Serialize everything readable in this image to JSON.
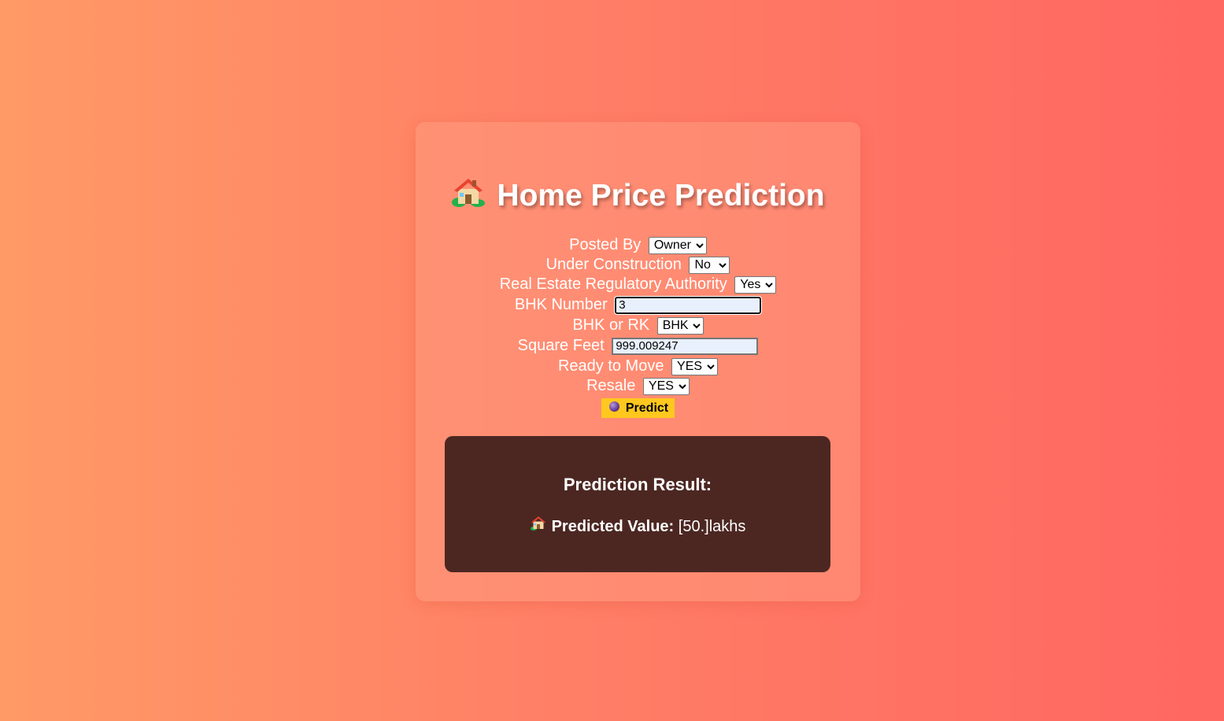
{
  "title": "Home Price Prediction",
  "icons": {
    "title": "house-icon",
    "predict": "crystal-ball-icon",
    "result": "house-icon"
  },
  "form": {
    "posted_by": {
      "label": "Posted By",
      "value": "Owner",
      "options": [
        "Owner"
      ]
    },
    "under_construction": {
      "label": "Under Construction",
      "value": "No",
      "options": [
        "No"
      ]
    },
    "rera": {
      "label": "Real Estate Regulatory Authority",
      "value": "Yes",
      "options": [
        "Yes"
      ]
    },
    "bhk_number": {
      "label": "BHK Number",
      "value": "3"
    },
    "bhk_or_rk": {
      "label": "BHK or RK",
      "value": "BHK",
      "options": [
        "BHK"
      ]
    },
    "square_feet": {
      "label": "Square Feet",
      "value": "999.009247"
    },
    "ready_to_move": {
      "label": "Ready to Move",
      "value": "YES",
      "options": [
        "YES"
      ]
    },
    "resale": {
      "label": "Resale",
      "value": "YES",
      "options": [
        "YES"
      ]
    },
    "predict_label": "Predict"
  },
  "result": {
    "title": "Prediction Result:",
    "label": "Predicted Value:",
    "value": "[50.]lakhs"
  },
  "colors": {
    "accent_button": "#ffc81e",
    "result_bg": "#4c2722",
    "gradient_start": "#ff9a66",
    "gradient_end": "#ff6761"
  }
}
